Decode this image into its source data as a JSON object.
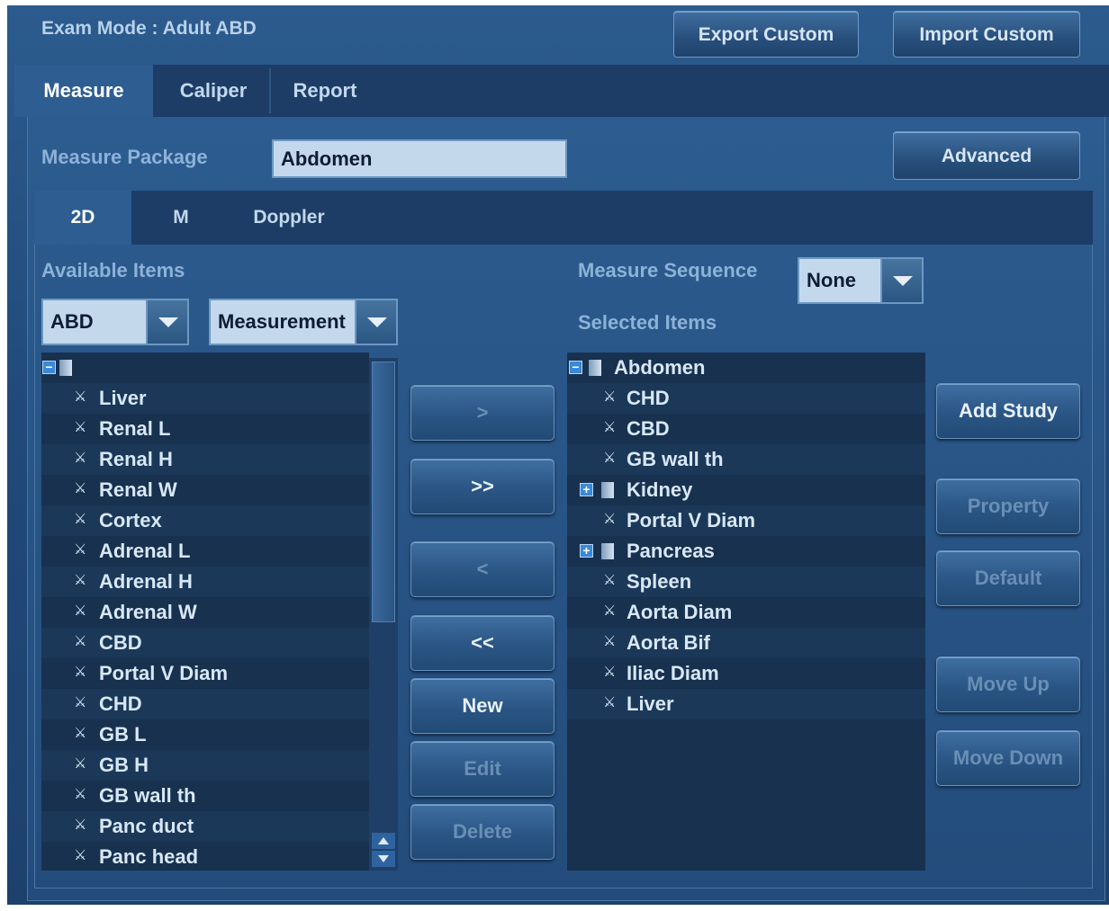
{
  "title": "Exam Mode : Adult ABD",
  "top_buttons": {
    "export": "Export Custom",
    "import": "Import Custom"
  },
  "tabs": [
    "Measure",
    "Caliper",
    "Report"
  ],
  "active_tab": "Measure",
  "measure_package": {
    "label": "Measure Package",
    "value": "Abdomen",
    "advanced": "Advanced"
  },
  "subtabs": [
    "2D",
    "M",
    "Doppler"
  ],
  "active_subtab": "2D",
  "available": {
    "label": "Available Items",
    "filter_app": "ABD",
    "filter_type": "Measurement",
    "items": [
      "Liver",
      "Renal L",
      "Renal H",
      "Renal W",
      "Cortex",
      "Adrenal L",
      "Adrenal H",
      "Adrenal W",
      "CBD",
      "Portal V Diam",
      "CHD",
      "GB L",
      "GB H",
      "GB wall th",
      "Panc duct",
      "Panc head"
    ]
  },
  "transfer_buttons": {
    "add_one": ">",
    "add_all": ">>",
    "remove_one": "<",
    "remove_all": "<<",
    "new": "New",
    "edit": "Edit",
    "delete": "Delete"
  },
  "sequence": {
    "label": "Measure Sequence",
    "value": "None"
  },
  "selected": {
    "label": "Selected Items",
    "root": "Abdomen",
    "items": [
      {
        "name": "CHD",
        "type": "leaf"
      },
      {
        "name": "CBD",
        "type": "leaf"
      },
      {
        "name": "GB wall th",
        "type": "leaf"
      },
      {
        "name": "Kidney",
        "type": "group"
      },
      {
        "name": "Portal V Diam",
        "type": "leaf"
      },
      {
        "name": "Pancreas",
        "type": "group"
      },
      {
        "name": "Spleen",
        "type": "leaf"
      },
      {
        "name": "Aorta Diam",
        "type": "leaf"
      },
      {
        "name": "Aorta Bif",
        "type": "leaf"
      },
      {
        "name": "Iliac Diam",
        "type": "leaf"
      },
      {
        "name": "Liver",
        "type": "leaf"
      }
    ]
  },
  "side_buttons": {
    "add_study": "Add Study",
    "property": "Property",
    "default": "Default",
    "move_up": "Move Up",
    "move_down": "Move Down"
  },
  "icons": {
    "leaf": "caliper-leaf-icon",
    "expand": "expand-plus-icon",
    "collapse": "collapse-minus-icon",
    "folder": "folder-icon"
  }
}
